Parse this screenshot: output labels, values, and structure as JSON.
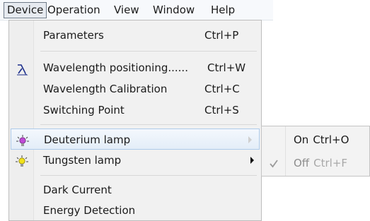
{
  "menubar": {
    "items": [
      {
        "label": "Device"
      },
      {
        "label": "Operation"
      },
      {
        "label": "View"
      },
      {
        "label": "Window"
      },
      {
        "label": "Help"
      }
    ]
  },
  "device_menu": {
    "items": [
      {
        "label": "Parameters",
        "shortcut": "Ctrl+P",
        "icon": ""
      },
      {
        "label": "Wavelength positioning......",
        "shortcut": "Ctrl+W",
        "icon": "lambda-icon"
      },
      {
        "label": "Wavelength Calibration",
        "shortcut": "Ctrl+C",
        "icon": ""
      },
      {
        "label": "Switching Point",
        "shortcut": "Ctrl+S",
        "icon": ""
      },
      {
        "label": "Deuterium lamp",
        "shortcut": "",
        "icon": "lamp-purple-icon"
      },
      {
        "label": "Tungsten lamp",
        "shortcut": "",
        "icon": "lamp-yellow-icon"
      },
      {
        "label": "Dark Current",
        "shortcut": "",
        "icon": ""
      },
      {
        "label": "Energy Detection",
        "shortcut": "",
        "icon": ""
      }
    ]
  },
  "submenu": {
    "items": [
      {
        "label": "On",
        "shortcut": "Ctrl+O",
        "checked": false,
        "enabled": true
      },
      {
        "label": "Off",
        "shortcut": "Ctrl+F",
        "checked": true,
        "enabled": false
      }
    ]
  },
  "colors": {
    "hover_border": "#aecbea",
    "lamp_purple": "#c04bd6",
    "lamp_yellow": "#f2e21b",
    "lambda_blue": "#1d2f8c"
  }
}
